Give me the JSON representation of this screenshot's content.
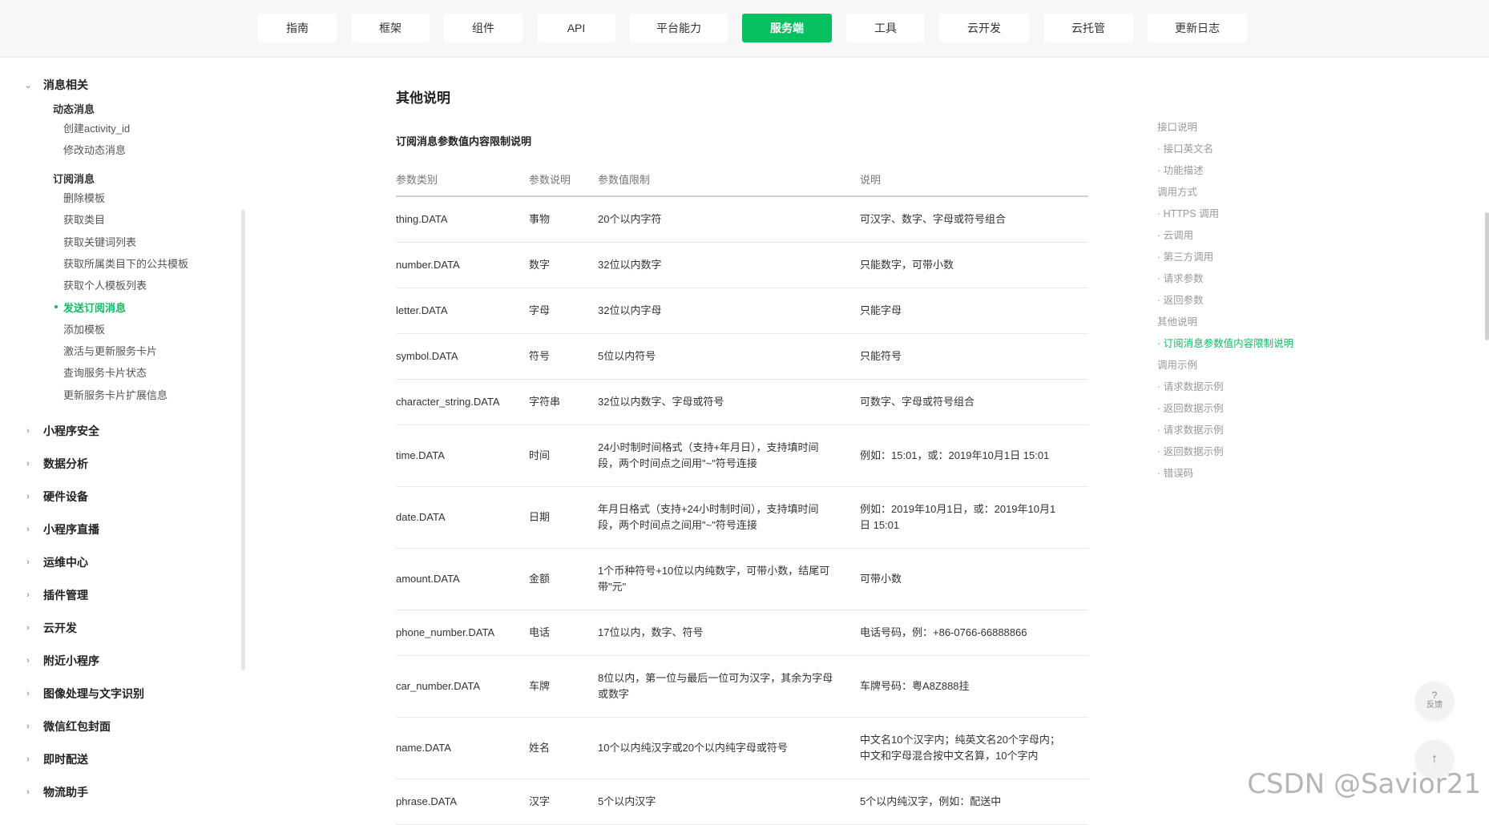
{
  "nav": {
    "tabs": [
      {
        "label": "指南",
        "active": false
      },
      {
        "label": "框架",
        "active": false
      },
      {
        "label": "组件",
        "active": false
      },
      {
        "label": "API",
        "active": false
      },
      {
        "label": "平台能力",
        "active": false
      },
      {
        "label": "服务端",
        "active": true
      },
      {
        "label": "工具",
        "active": false
      },
      {
        "label": "云开发",
        "active": false
      },
      {
        "label": "云托管",
        "active": false
      },
      {
        "label": "更新日志",
        "active": false
      }
    ]
  },
  "sidebar": {
    "expanded_group": "消息相关",
    "dynamic_head": "动态消息",
    "dynamic_items": [
      "创建activity_id",
      "修改动态消息"
    ],
    "subscribe_head": "订阅消息",
    "subscribe_items": [
      "删除模板",
      "获取类目",
      "获取关键词列表",
      "获取所属类目下的公共模板",
      "获取个人模板列表",
      "发送订阅消息",
      "添加模板",
      "激活与更新服务卡片",
      "查询服务卡片状态",
      "更新服务卡片扩展信息"
    ],
    "active_item": "发送订阅消息",
    "collapsed_groups": [
      "小程序安全",
      "数据分析",
      "硬件设备",
      "小程序直播",
      "运维中心",
      "插件管理",
      "云开发",
      "附近小程序",
      "图像处理与文字识别",
      "微信红包封面",
      "即时配送",
      "物流助手"
    ]
  },
  "content": {
    "heading": "其他说明",
    "subheading": "订阅消息参数值内容限制说明",
    "columns": [
      "参数类别",
      "参数说明",
      "参数值限制",
      "说明"
    ],
    "rows": [
      [
        "thing.DATA",
        "事物",
        "20个以内字符",
        "可汉字、数字、字母或符号组合"
      ],
      [
        "number.DATA",
        "数字",
        "32位以内数字",
        "只能数字，可带小数"
      ],
      [
        "letter.DATA",
        "字母",
        "32位以内字母",
        "只能字母"
      ],
      [
        "symbol.DATA",
        "符号",
        "5位以内符号",
        "只能符号"
      ],
      [
        "character_string.DATA",
        "字符串",
        "32位以内数字、字母或符号",
        "可数字、字母或符号组合"
      ],
      [
        "time.DATA",
        "时间",
        "24小时制时间格式（支持+年月日），支持填时间段，两个时间点之间用\"~\"符号连接",
        "例如：15:01，或：2019年10月1日 15:01"
      ],
      [
        "date.DATA",
        "日期",
        "年月日格式（支持+24小时制时间），支持填时间段，两个时间点之间用\"~\"符号连接",
        "例如：2019年10月1日，或：2019年10月1日 15:01"
      ],
      [
        "amount.DATA",
        "金额",
        "1个币种符号+10位以内纯数字，可带小数，结尾可带\"元\"",
        "可带小数"
      ],
      [
        "phone_number.DATA",
        "电话",
        "17位以内，数字、符号",
        "电话号码，例：+86-0766-66888866"
      ],
      [
        "car_number.DATA",
        "车牌",
        "8位以内，第一位与最后一位可为汉字，其余为字母或数字",
        "车牌号码：粤A8Z888挂"
      ],
      [
        "name.DATA",
        "姓名",
        "10个以内纯汉字或20个以内纯字母或符号",
        "中文名10个汉字内；纯英文名20个字母内；中文和字母混合按中文名算，10个字内"
      ],
      [
        "phrase.DATA",
        "汉字",
        "5个以内汉字",
        "5个以内纯汉字，例如：配送中"
      ]
    ]
  },
  "toc": {
    "items": [
      {
        "label": "接口说明",
        "child": false
      },
      {
        "label": "· 接口英文名",
        "child": true
      },
      {
        "label": "· 功能描述",
        "child": true
      },
      {
        "label": "调用方式",
        "child": false
      },
      {
        "label": "· HTTPS 调用",
        "child": true
      },
      {
        "label": "· 云调用",
        "child": true
      },
      {
        "label": "· 第三方调用",
        "child": true
      },
      {
        "label": "· 请求参数",
        "child": true
      },
      {
        "label": "· 返回参数",
        "child": true
      },
      {
        "label": "其他说明",
        "child": false
      },
      {
        "label": "· 订阅消息参数值内容限制说明",
        "child": true,
        "active": true
      },
      {
        "label": "调用示例",
        "child": false
      },
      {
        "label": "· 请求数据示例",
        "child": true
      },
      {
        "label": "· 返回数据示例",
        "child": true
      },
      {
        "label": "· 请求数据示例",
        "child": true
      },
      {
        "label": "· 返回数据示例",
        "child": true
      },
      {
        "label": "· 错误码",
        "child": true
      }
    ]
  },
  "feedback": {
    "icon_glyph": "?",
    "label": "反馈"
  },
  "back_to_top": {
    "glyph": "↑"
  },
  "watermark": "CSDN @Savior21",
  "colors": {
    "accent": "#07c160"
  }
}
